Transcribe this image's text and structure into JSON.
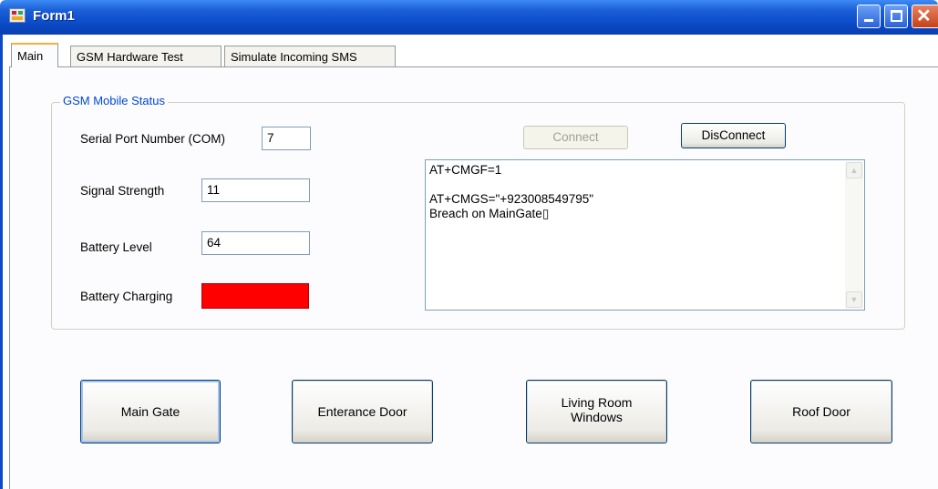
{
  "window": {
    "title": "Form1"
  },
  "tabs": [
    {
      "label": "Main",
      "active": true
    },
    {
      "label": "GSM Hardware Test",
      "active": false
    },
    {
      "label": "Simulate Incoming SMS",
      "active": false
    }
  ],
  "status_group": {
    "title": "GSM Mobile Status",
    "serial_port_label": "Serial Port Number (COM)",
    "serial_port_value": "7",
    "signal_label": "Signal Strength",
    "signal_value": "11",
    "battery_label": "Battery Level",
    "battery_value": "64",
    "charging_label": "Battery Charging",
    "charging_indicator_color": "#ff0000",
    "connect_label": "Connect",
    "disconnect_label": "DisConnect",
    "log_lines": [
      "AT+CMGF=1",
      "",
      "AT+CMGS=\"+923008549795\"",
      "Breach on MainGate▯"
    ]
  },
  "location_buttons": {
    "main_gate": "Main Gate",
    "enterance_door": "Enterance Door",
    "living_room_windows": "Living Room Windows",
    "roof_door": "Roof Door"
  }
}
